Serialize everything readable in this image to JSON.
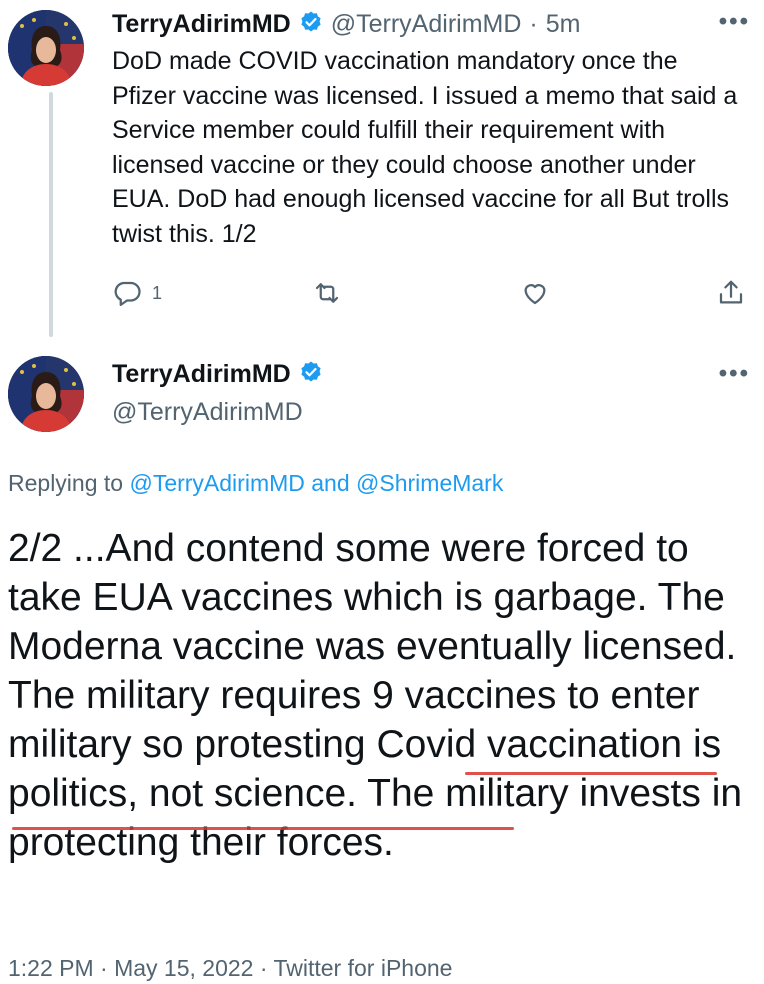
{
  "tweet1": {
    "display_name": "TerryAdirimMD",
    "handle": "@TerryAdirimMD",
    "separator": "·",
    "time": "5m",
    "text": "DoD made COVID vaccination mandatory once the Pfizer vaccine was licensed. I issued a memo that said a Service member could fulfill their requirement with licensed vaccine or they could choose another under EUA. DoD had enough licensed vaccine for all But trolls twist this. 1/2",
    "reply_count": "1"
  },
  "tweet2": {
    "display_name": "TerryAdirimMD",
    "handle": "@TerryAdirimMD",
    "replying_prefix": "Replying to",
    "replying_to_1": "@TerryAdirimMD",
    "replying_and": "and",
    "replying_to_2": "@ShrimeMark",
    "text": "2/2 ...And contend some were forced to take EUA vaccines which is garbage. The Moderna vaccine was eventually licensed. The military requires 9 vaccines to enter military so protesting Covid vaccination is politics, not science. The military invests in protecting their forces.",
    "footer": "1:22 PM · May 15, 2022 · Twitter for iPhone"
  },
  "more_label": "•••",
  "icons": {
    "verified": "verified-badge-icon",
    "reply": "reply-icon",
    "retweet": "retweet-icon",
    "like": "heart-icon",
    "share": "share-icon",
    "more": "more-icon"
  },
  "colors": {
    "verified": "#1d9bf0",
    "link": "#1d9bf0",
    "annotation": "#d9342b",
    "muted": "#536471"
  }
}
